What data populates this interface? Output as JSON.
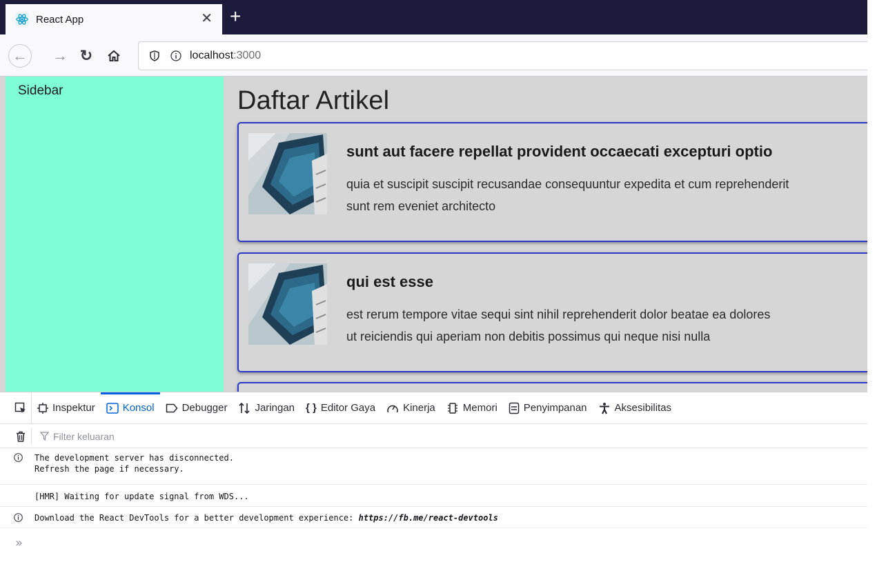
{
  "browser": {
    "tab": {
      "title": "React App",
      "favicon": "react-logo-icon"
    },
    "nav": {
      "url_host": "localhost",
      "url_port": ":3000"
    }
  },
  "page": {
    "sidebar_label": "Sidebar",
    "title": "Daftar Artikel",
    "articles": [
      {
        "title": "sunt aut facere repellat provident occaecati excepturi optio",
        "body_line1": "quia et suscipit suscipit recusandae consequuntur expedita et cum reprehenderit",
        "body_line2": "sunt rem eveniet architecto"
      },
      {
        "title": "qui est esse",
        "body_line1": "est rerum tempore vitae sequi sint nihil reprehenderit dolor beatae ea dolores",
        "body_line2": "ut reiciendis qui aperiam non debitis possimus qui neque nisi nulla"
      }
    ],
    "colors": {
      "sidebar": "#7ffdd5",
      "card_border": "#2a37c9",
      "background": "#d5d5d5"
    }
  },
  "devtools": {
    "tabs": [
      {
        "label": "Inspektur",
        "icon": "inspector-icon"
      },
      {
        "label": "Konsol",
        "icon": "console-icon",
        "active": true
      },
      {
        "label": "Debugger",
        "icon": "debugger-icon"
      },
      {
        "label": "Jaringan",
        "icon": "network-icon"
      },
      {
        "label": "Editor Gaya",
        "icon": "style-editor-icon"
      },
      {
        "label": "Kinerja",
        "icon": "performance-icon"
      },
      {
        "label": "Memori",
        "icon": "memory-icon"
      },
      {
        "label": "Penyimpanan",
        "icon": "storage-icon"
      },
      {
        "label": "Aksesibilitas",
        "icon": "accessibility-icon"
      }
    ],
    "filter_placeholder": "Filter keluaran",
    "messages": {
      "m1_line1": "The development server has disconnected.",
      "m1_line2": "Refresh the page if necessary.",
      "m2": "[HMR] Waiting for update signal from WDS...",
      "m3_text": "Download the React DevTools for a better development experience: ",
      "m3_url": "https://fb.me/react-devtools"
    },
    "prompt": "»"
  }
}
